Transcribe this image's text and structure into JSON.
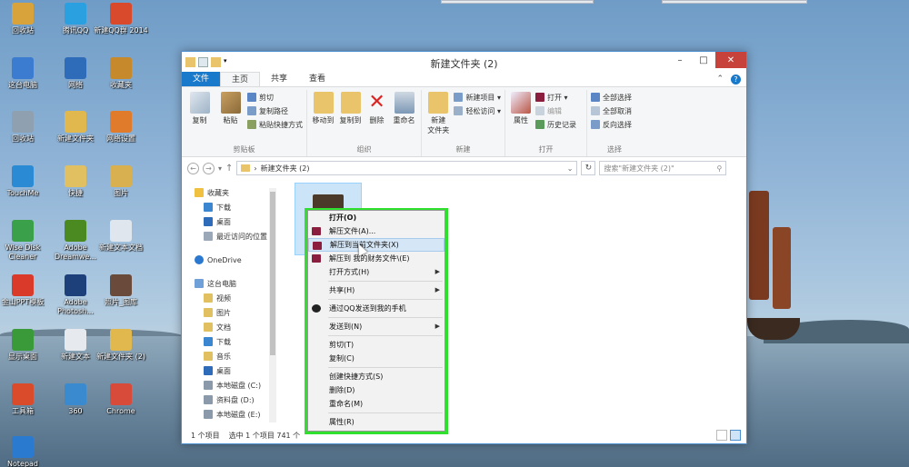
{
  "desktop": {
    "icons": [
      {
        "label": "回收站",
        "color": "#d8a33a"
      },
      {
        "label": "腾讯QQ",
        "color": "#2aa0e0"
      },
      {
        "label": "新建QQ群 2014",
        "color": "#d9492b"
      },
      {
        "label": "这台电脑",
        "color": "#3b7bd0"
      },
      {
        "label": "网络",
        "color": "#2e6bb8"
      },
      {
        "label": "收藏夹",
        "color": "#c6892b"
      },
      {
        "label": "回收站",
        "color": "#8fa0b0"
      },
      {
        "label": "新建文件夹",
        "color": "#e0b84e"
      },
      {
        "label": "网络设置",
        "color": "#e07b2b"
      },
      {
        "label": "TouchMe",
        "color": "#2b8ad4"
      },
      {
        "label": "快捷",
        "color": "#e0c060"
      },
      {
        "label": "图片",
        "color": "#d8b050"
      },
      {
        "label": "Wise Disk Cleaner",
        "color": "#3aa04a"
      },
      {
        "label": "Adobe Dreamwe...",
        "color": "#4a8a20"
      },
      {
        "label": "新建文本文档",
        "color": "#dfe6ee"
      },
      {
        "label": "金山PPT模板",
        "color": "#d93a2a"
      },
      {
        "label": "Adobe Photosh...",
        "color": "#1d3f7a"
      },
      {
        "label": "照片_图库",
        "color": "#6a4a3a"
      },
      {
        "label": "显示桌面",
        "color": "#3a9a3a"
      },
      {
        "label": "新建文本",
        "color": "#e6eaef"
      },
      {
        "label": "新建文件夹 (2)",
        "color": "#e0b84e"
      },
      {
        "label": "工具箱",
        "color": "#d94b2b"
      },
      {
        "label": "360",
        "color": "#3a8ad0"
      },
      {
        "label": "Chrome",
        "color": "#d84a3a"
      },
      {
        "label": "Notepad",
        "color": "#2a7ad0"
      }
    ]
  },
  "window": {
    "title": "新建文件夹 (2)",
    "controls": {
      "minimize": "–",
      "maximize": "□",
      "close": "✕"
    },
    "tabs": [
      "文件",
      "主页",
      "共享",
      "查看"
    ],
    "ribbon": {
      "clipboard": {
        "name": "剪贴板",
        "copy": "复制",
        "paste": "粘贴",
        "cut": "剪切",
        "copy_path": "复制路径",
        "paste_shortcut": "粘贴快捷方式"
      },
      "organize": {
        "name": "组织",
        "move_to": "移动到",
        "copy_to": "复制到",
        "delete": "删除",
        "rename": "重命名"
      },
      "new": {
        "name": "新建",
        "new_folder": "新建\n文件夹",
        "new_item": "新建项目 ▾",
        "easy_access": "轻松访问 ▾"
      },
      "open": {
        "name": "打开",
        "properties": "属性",
        "open": "打开 ▾",
        "edit": "编辑",
        "history": "历史记录"
      },
      "select": {
        "name": "选择",
        "select_all": "全部选择",
        "select_none": "全部取消",
        "invert": "反向选择"
      }
    },
    "address": {
      "path": "新建文件夹 (2)",
      "search_placeholder": "搜索\"新建文件夹 (2)\""
    },
    "nav": {
      "favorites": "收藏夹",
      "fav_items": [
        "下载",
        "桌面",
        "最近访问的位置"
      ],
      "onedrive": "OneDrive",
      "this_pc": "这台电脑",
      "pc_items": [
        "视频",
        "图片",
        "文档",
        "下载",
        "音乐",
        "桌面",
        "本地磁盘 (C:)",
        "资料盘 (D:)",
        "本地磁盘 (E:)"
      ]
    },
    "status": {
      "items": "1 个项目",
      "selected": "选中 1 个项目  741 个"
    }
  },
  "context_menu": {
    "items": [
      {
        "label": "打开(O)",
        "bold": true,
        "icon": "",
        "arrow": false,
        "sep_after": false
      },
      {
        "label": "解压文件(A)...",
        "icon": "winrar-icon",
        "arrow": false,
        "sep_after": false
      },
      {
        "label": "解压到当前文件夹(X)",
        "icon": "winrar-icon",
        "arrow": false,
        "highlight": true,
        "sep_after": false
      },
      {
        "label": "解压到 我的财务文件\\(E)",
        "icon": "winrar-icon",
        "arrow": false,
        "sep_after": false
      },
      {
        "label": "打开方式(H)",
        "icon": "",
        "arrow": true,
        "sep_after": true
      },
      {
        "label": "共享(H)",
        "icon": "",
        "arrow": true,
        "sep_after": true
      },
      {
        "label": "通过QQ发送到我的手机",
        "icon": "qq-icon",
        "arrow": false,
        "sep_after": true
      },
      {
        "label": "发送到(N)",
        "icon": "",
        "arrow": true,
        "sep_after": true
      },
      {
        "label": "剪切(T)",
        "icon": "",
        "arrow": false,
        "sep_after": false
      },
      {
        "label": "复制(C)",
        "icon": "",
        "arrow": false,
        "sep_after": true
      },
      {
        "label": "创建快捷方式(S)",
        "icon": "",
        "arrow": false,
        "sep_after": false
      },
      {
        "label": "删除(D)",
        "icon": "",
        "arrow": false,
        "sep_after": false
      },
      {
        "label": "重命名(M)",
        "icon": "",
        "arrow": false,
        "sep_after": true
      },
      {
        "label": "属性(R)",
        "icon": "",
        "arrow": false,
        "sep_after": false
      }
    ]
  }
}
